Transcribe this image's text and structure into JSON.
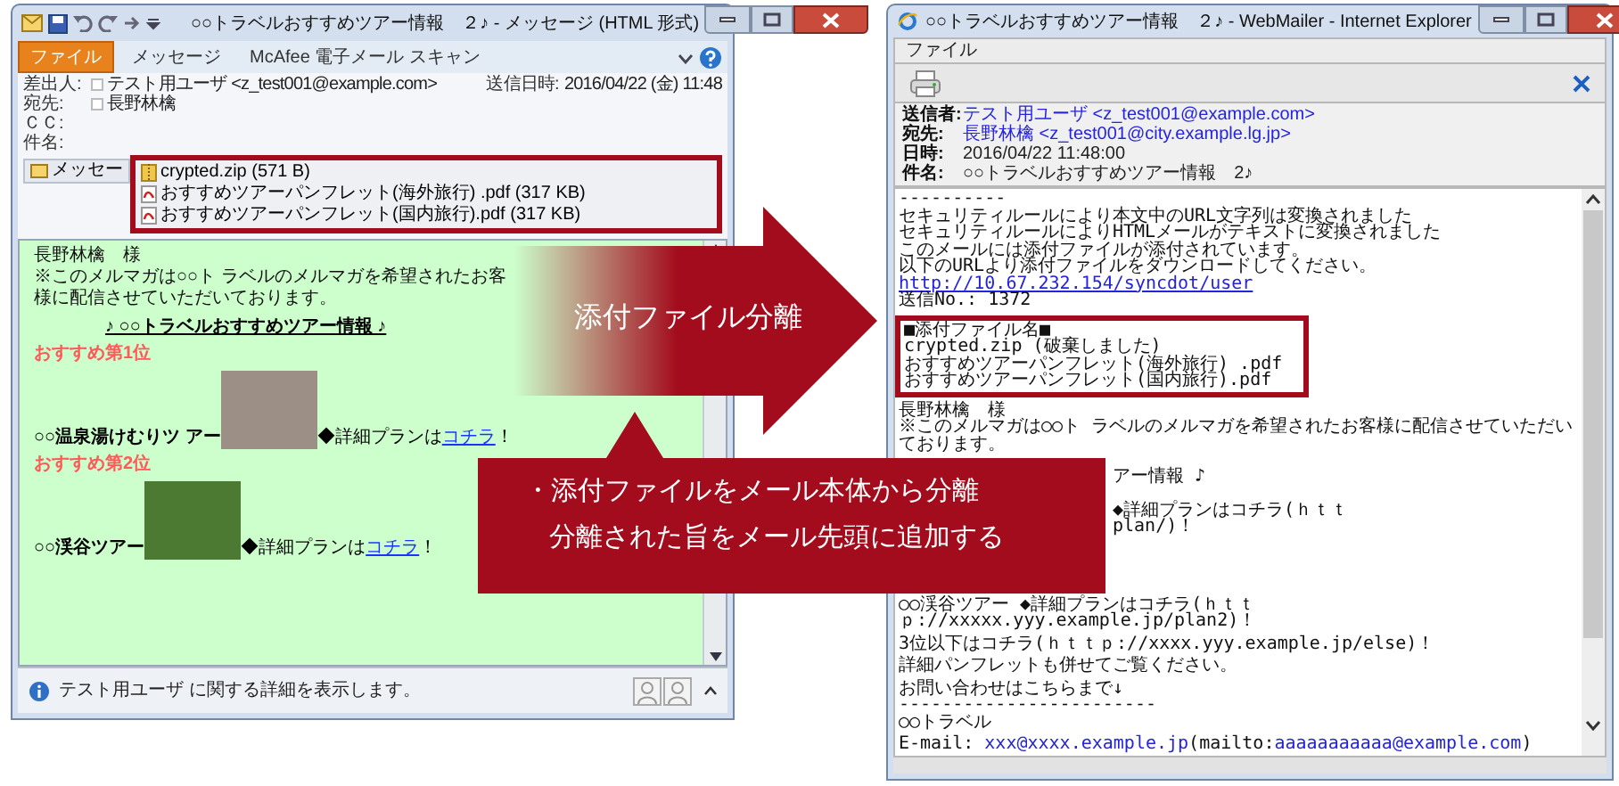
{
  "left_window": {
    "title": "○○トラベルおすすめツアー情報　２♪ - メッセージ (HTML 形式)",
    "ribbon_tabs": [
      {
        "label": "ファイル",
        "selected": true
      },
      {
        "label": "メッセージ",
        "selected": false
      },
      {
        "label": "McAfee 電子メール スキャン",
        "selected": false
      }
    ],
    "header": [
      {
        "label": "差出人:",
        "value": "テスト用ユーザ <z_test001@example.com>"
      },
      {
        "label": "宛先:",
        "value": "長野林檎"
      },
      {
        "label": "ＣＣ:"
      },
      {
        "label": "件名:"
      }
    ],
    "sent": {
      "label": "送信日時:",
      "value": "2016/04/22 (金) 11:48"
    },
    "message_tab": "メッセー",
    "attachments": [
      {
        "kind": "zip",
        "name": "crypted.zip (571 B)"
      },
      {
        "kind": "pdf",
        "name": "おすすめツアーパンフレット(海外旅行) .pdf (317 KB)"
      },
      {
        "kind": "pdf",
        "name": "おすすめツアーパンフレット(国内旅行).pdf (317 KB)"
      }
    ],
    "body": [
      {
        "kind": "text",
        "text": "長野林檎　様"
      },
      {
        "kind": "text",
        "text": "※このメルマガは○○ト ラベルのメルマガを希望されたお客様に配信させていただいております。"
      },
      {
        "kind": "heading",
        "text": "♪ ○○トラベルおすすめツアー情報 ♪"
      },
      {
        "kind": "rank",
        "text": "おすすめ第1位"
      },
      {
        "kind": "tour",
        "name": "○○温泉湯けむりツ アー",
        "detail": "◆詳細プランは",
        "link": "コチラ",
        "end": "！"
      },
      {
        "kind": "rank",
        "text": "おすすめ第2位"
      },
      {
        "kind": "tour",
        "name": "○○渓谷ツアー",
        "detail": "◆詳細プランは",
        "link": "コチラ",
        "end": "！"
      }
    ],
    "status_bar": "テスト用ユーザ に関する詳細を表示します。"
  },
  "arrow_callout": "添付ファイル分離",
  "note_callout": [
    "・添付ファイルをメール本体から分離",
    "分離された旨をメール先頭に追加する"
  ],
  "right_window": {
    "title": "○○トラベルおすすめツアー情報　２♪ - WebMailer - Internet Explorer",
    "menu": [
      "ファイル"
    ],
    "header": [
      {
        "label": "送信者:",
        "value": "テスト用ユーザ <z_test001@example.com>",
        "link": true
      },
      {
        "label": "宛先:",
        "value": "長野林檎 <z_test001@city.example.lg.jp>",
        "link": true
      },
      {
        "label": "日時:",
        "value": "2016/04/22 11:48:00",
        "link": false
      },
      {
        "label": "件名:",
        "value": "○○トラベルおすすめツアー情報　2♪",
        "link": false
      }
    ],
    "body": [
      {
        "boxed": false,
        "lines": [
          {
            "kind": "text",
            "text": "----------"
          },
          {
            "kind": "text",
            "text": "セキュリティルールにより本文中のURL文字列は変換されました"
          },
          {
            "kind": "text",
            "text": "セキュリティルールによりHTMLメールがテキストに変換されました"
          },
          {
            "kind": "text",
            "text": "このメールには添付ファイルが添付されています。"
          },
          {
            "kind": "text",
            "text": "以下のURLより添付ファイルをダウンロードしてください。"
          },
          {
            "kind": "link",
            "text": "http://10.67.232.154/syncdot/user"
          },
          {
            "kind": "text",
            "text": "送信No.: 1372"
          }
        ]
      },
      {
        "boxed": true,
        "lines": [
          {
            "kind": "text",
            "text": "■添付ファイル名■"
          },
          {
            "kind": "text",
            "text": "crypted.zip (破棄しました)"
          },
          {
            "kind": "text",
            "text": "おすすめツアーパンフレット(海外旅行) .pdf"
          },
          {
            "kind": "text",
            "text": "おすすめツアーパンフレット(国内旅行).pdf"
          }
        ]
      },
      {
        "boxed": false,
        "lines": [
          {
            "kind": "text",
            "text": "長野林檎　様"
          },
          {
            "kind": "text",
            "text": "※このメルマガは○○ト ラベルのメルマガを希望されたお客様に配信させていただいております。"
          }
        ]
      },
      {
        "boxed": false,
        "lines": [
          {
            "kind": "partial",
            "text": "アー情報 ♪"
          }
        ]
      },
      {
        "boxed": false,
        "lines": [
          {
            "kind": "partial",
            "text": "◆詳細プランはコチラ(ｈｔｔ"
          },
          {
            "kind": "partial",
            "text": "plan/)！"
          }
        ]
      },
      {
        "boxed": false,
        "lines": [
          {
            "kind": "text",
            "text": "○○渓谷ツアー ◆詳細プランはコチラ(ｈｔｔｐ://xxxxx.yyy.example.jp/plan2)！"
          }
        ]
      },
      {
        "boxed": false,
        "lines": [
          {
            "kind": "text",
            "text": "3位以下はコチラ(ｈｔｔｐ://xxxx.yyy.example.jp/else)！"
          }
        ]
      },
      {
        "boxed": false,
        "lines": [
          {
            "kind": "text",
            "text": "詳細パンフレットも併せてご覧ください。"
          }
        ]
      },
      {
        "boxed": false,
        "lines": [
          {
            "kind": "text",
            "text": "お問い合わせはこちらまで↓"
          },
          {
            "kind": "text",
            "text": "------------------------"
          },
          {
            "kind": "text",
            "text": "○○トラベル"
          }
        ]
      },
      {
        "boxed": false,
        "lines": [
          {
            "kind": "contact",
            "parts": [
              {
                "text": "E-mail:",
                "link": false
              },
              {
                "text": "xxx@xxxx.example.jp",
                "link": true
              },
              {
                "text": "(mailto:",
                "link": false
              },
              {
                "text": "aaaaaaaaaaa@example.com",
                "link": true
              },
              {
                "text": ")",
                "link": false
              }
            ]
          }
        ]
      }
    ]
  }
}
